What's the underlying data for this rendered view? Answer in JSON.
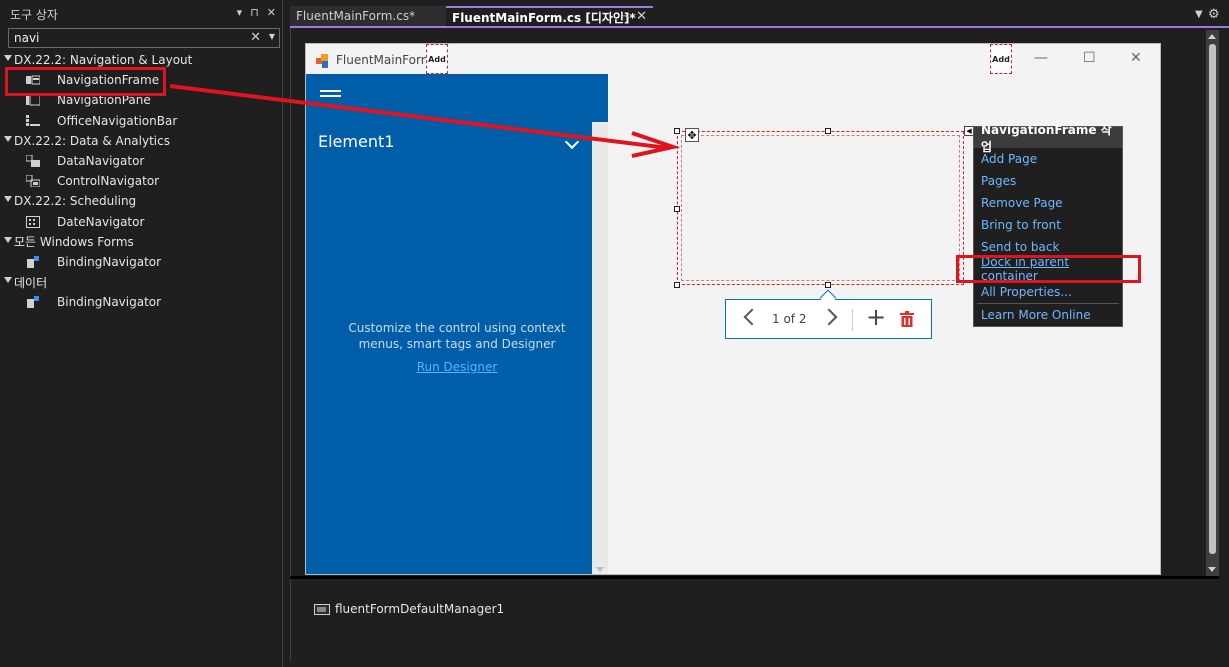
{
  "toolbox": {
    "title": "도구 상자",
    "search_value": "navi",
    "groups": [
      {
        "label": "DX.22.2: Navigation & Layout",
        "items": [
          "NavigationFrame",
          "NavigationPane",
          "OfficeNavigationBar"
        ]
      },
      {
        "label": "DX.22.2: Data & Analytics",
        "items": [
          "DataNavigator",
          "ControlNavigator"
        ]
      },
      {
        "label": "DX.22.2: Scheduling",
        "items": [
          "DateNavigator"
        ]
      },
      {
        "label": "모든 Windows Forms",
        "items": [
          "BindingNavigator"
        ]
      },
      {
        "label": "데이터",
        "items": [
          "BindingNavigator"
        ]
      }
    ]
  },
  "tabs": [
    {
      "label": "FluentMainForm.cs*"
    },
    {
      "label": "FluentMainForm.cs [디자인]*"
    }
  ],
  "form": {
    "title": "FluentMainForm",
    "add_label": "Add",
    "nav_element": "Element1",
    "hint": "Customize the control using context menus, smart tags and Designer",
    "run_designer": "Run Designer",
    "pager_text": "1 of 2"
  },
  "smart_menu": {
    "header": "NavigationFrame 작업",
    "items": [
      "Add Page",
      "Pages",
      "Remove Page",
      "Bring to front",
      "Send to back",
      "Dock in parent container",
      "All Properties...",
      "Learn More Online"
    ]
  },
  "tray": {
    "component": "fluentFormDefaultManager1"
  },
  "colors": {
    "accent": "#9d7bde",
    "nav_blue": "#005da8",
    "annotation_red": "#e0141e",
    "link_blue": "#6fb7ff"
  }
}
